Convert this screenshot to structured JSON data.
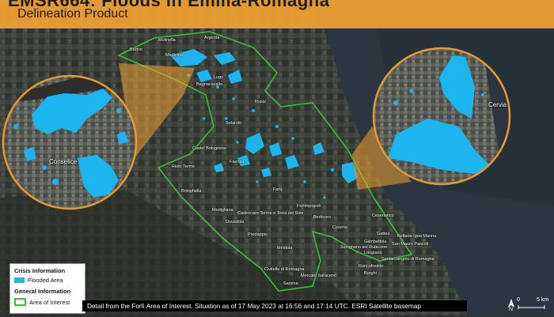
{
  "banner": {
    "title": "EMSR664: Floods in Emilia-Romagna",
    "subtitle": "Delineation Product"
  },
  "colors": {
    "banner": "#f2a233",
    "flooded": "#1cb5f0",
    "aoi": "#35c235",
    "sea": "#2b3640"
  },
  "legend": {
    "crisis_header": "Crisis Information",
    "flooded_label": "Flooded Area",
    "general_header": "General Information",
    "aoi_label": "Area of Interest"
  },
  "caption": "Detail from the Forlì Area of Interest. Situation as of 17 May 2023 at 16:56 and 17:14 UTC. ESRI Satellite basemap",
  "insets": {
    "left_label": "Conselice",
    "right_label": "Cervia"
  },
  "places": {
    "molinella": "Molinella",
    "argenta": "Argenta",
    "budrio": "Budrio",
    "medicina": "Medicina",
    "lugo": "Lugo",
    "bagnacavallo": "Bagnacavallo",
    "russi": "Russi",
    "solarolo": "Solarolo",
    "castel_bolognese": "Castel Bolognese",
    "faenza": "Faenza",
    "riolo_terme": "Riolo Terme",
    "brisighella": "Brisighella",
    "modigliana": "Modigliana",
    "dovadola": "Dovadola",
    "castrocaro": "Castrocaro Terme e Terra del Sole",
    "forli": "Forlì",
    "forlimpopoli": "Forlimpopoli",
    "bertinoro": "Bertinoro",
    "cesena": "Cesena",
    "cesenatico": "Cesenatico",
    "gatteo": "Gatteo",
    "bellaria": "Bellaria-Igea Marina",
    "gambettola": "Gambettola",
    "san_mauro": "San Mauro Pascoli",
    "savignano": "Savignano sul Rubicone",
    "longiano": "Longiano",
    "santarcangelo": "Santarcangelo di Romagna",
    "roncofreddo": "Roncofreddo",
    "borghi": "Borghi",
    "predappio": "Predappio",
    "meldola": "Meldola",
    "civitella": "Civitella di Romagna",
    "mercato": "Mercato Saraceno",
    "sarsina": "Sarsina"
  },
  "scale": {
    "zero": "0",
    "five": "5 km",
    "north": "N"
  }
}
